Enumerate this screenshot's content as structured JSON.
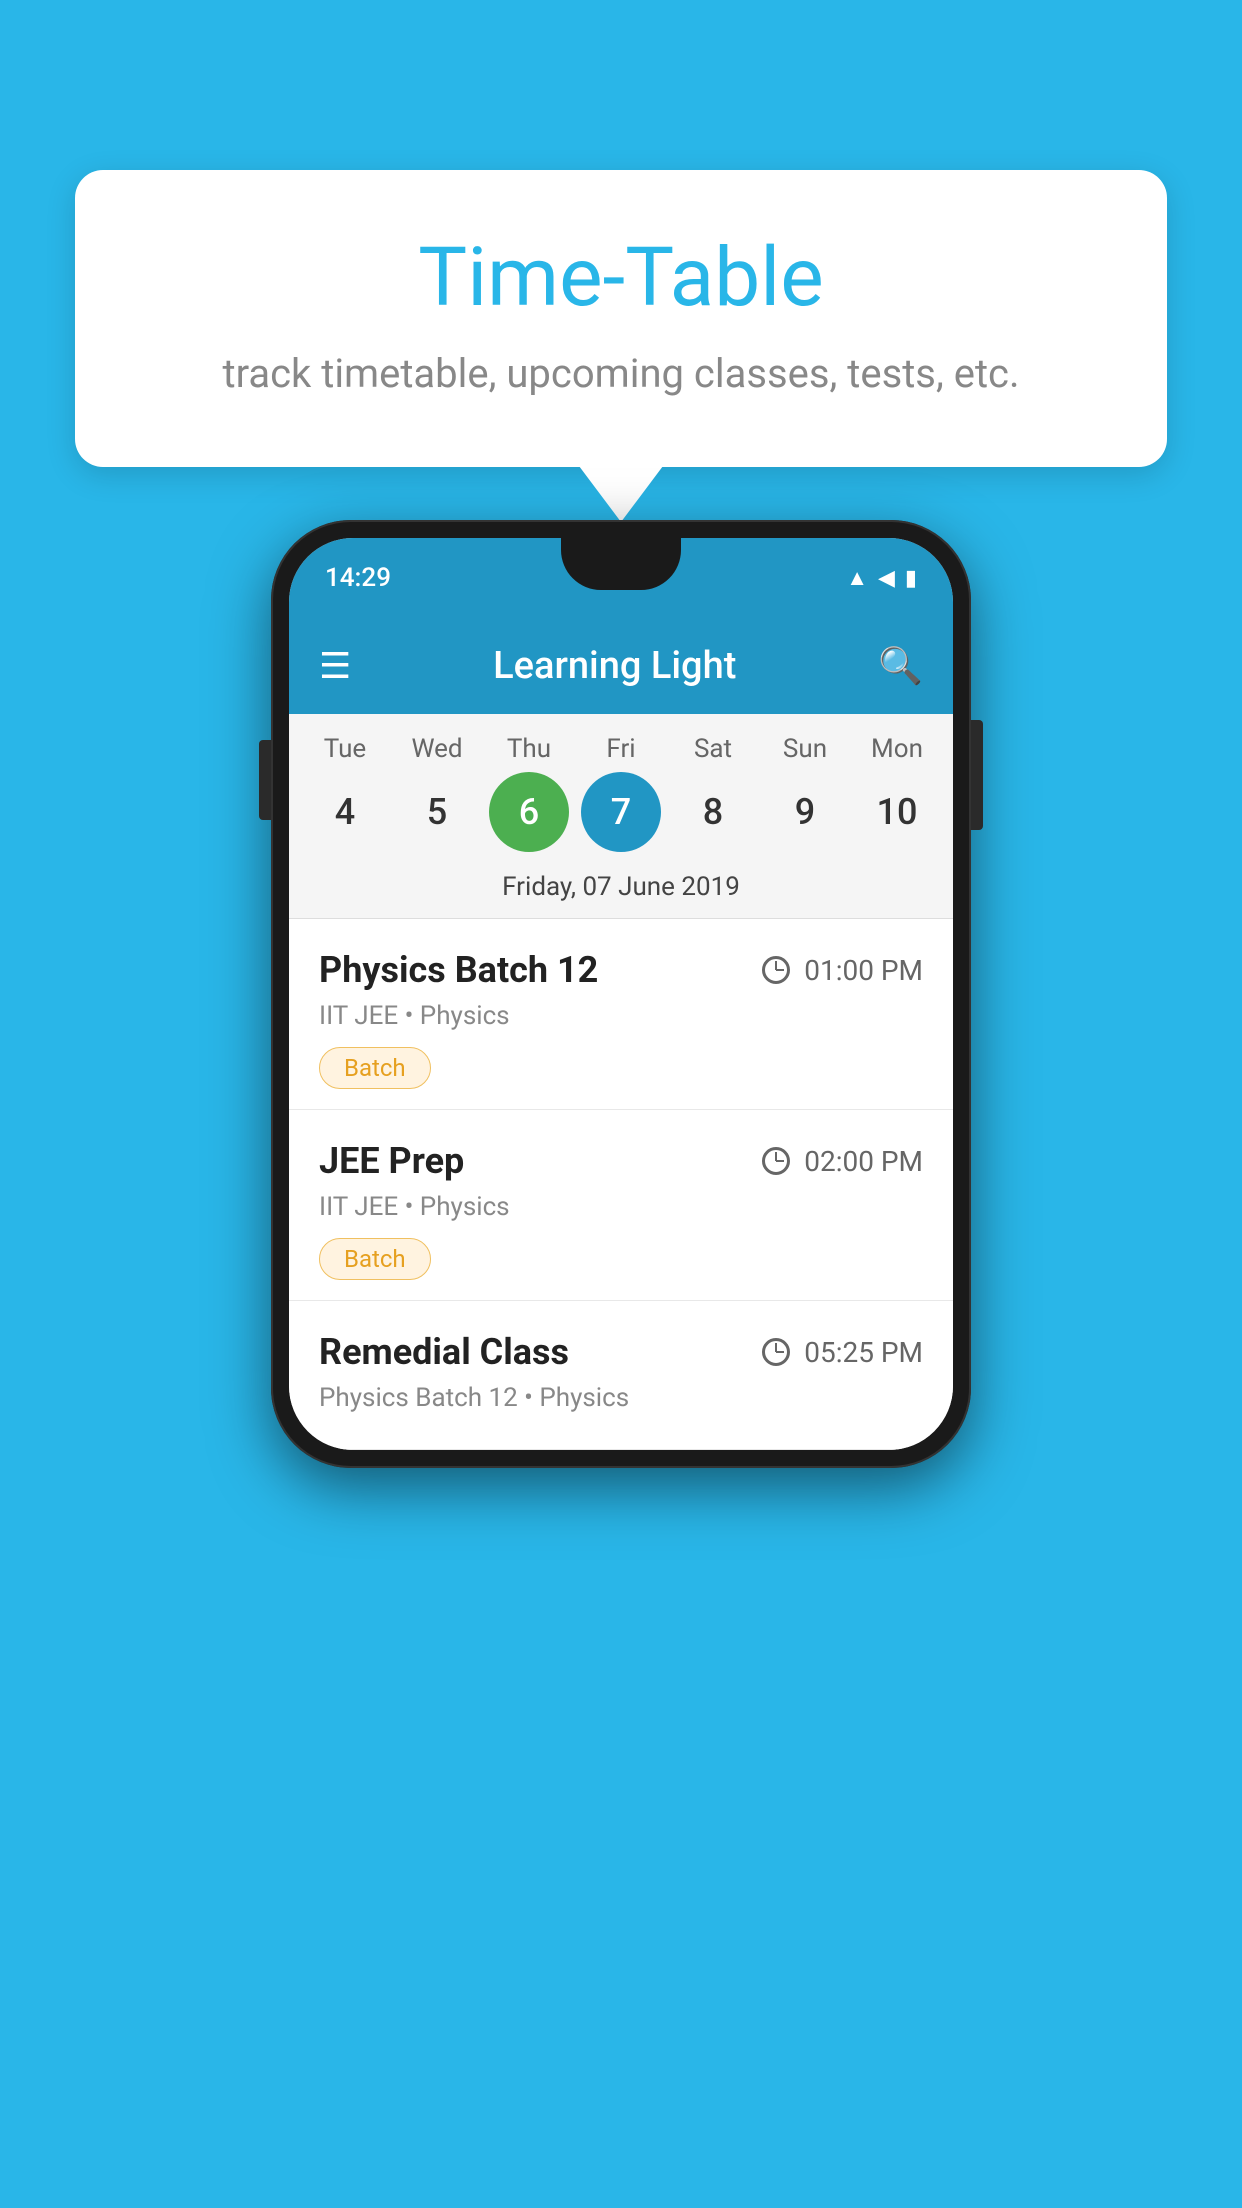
{
  "background_color": "#29b6e8",
  "tooltip": {
    "title": "Time-Table",
    "subtitle": "track timetable, upcoming classes, tests, etc."
  },
  "phone": {
    "status_bar": {
      "time": "14:29"
    },
    "app_bar": {
      "title": "Learning Light"
    },
    "calendar": {
      "days": [
        "Tue",
        "Wed",
        "Thu",
        "Fri",
        "Sat",
        "Sun",
        "Mon"
      ],
      "dates": [
        "4",
        "5",
        "6",
        "7",
        "8",
        "9",
        "10"
      ],
      "today_index": 2,
      "selected_index": 3,
      "selected_date_label": "Friday, 07 June 2019"
    },
    "schedule": [
      {
        "name": "Physics Batch 12",
        "time": "01:00 PM",
        "sub": "IIT JEE • Physics",
        "badge": "Batch"
      },
      {
        "name": "JEE Prep",
        "time": "02:00 PM",
        "sub": "IIT JEE • Physics",
        "badge": "Batch"
      },
      {
        "name": "Remedial Class",
        "time": "05:25 PM",
        "sub": "Physics Batch 12 • Physics",
        "badge": null
      }
    ]
  }
}
